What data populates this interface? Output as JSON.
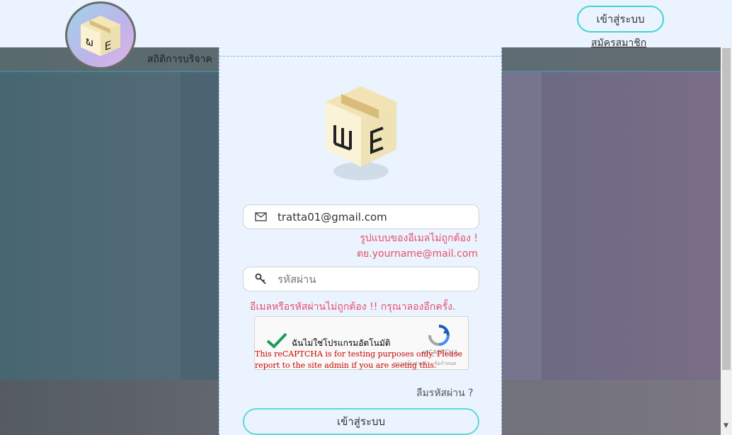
{
  "header": {
    "login_label": "เข้าสู่ระบบ",
    "signup_label": "สมัครสมาชิก",
    "logo_icon": "box-logo-icon"
  },
  "background": {
    "stat_label": "สถิติการบริจาค"
  },
  "modal": {
    "email": {
      "value": "tratta01@gmail.com",
      "icon": "envelope-icon",
      "error_line1": "รูปแบบของอีเมลไม่ถูกต้อง !",
      "error_line2": "ตย.yourname@mail.com"
    },
    "password": {
      "placeholder": "รหัสผ่าน",
      "icon": "key-icon"
    },
    "auth_error": "อีเมลหรือรหัสผ่านไม่ถูกต้อง !! กรุณาลองอีกครั้ง.",
    "captcha": {
      "label": "ฉันไม่ใช่โปรแกรมอัตโนมัติ",
      "brand": "reCAPTCHA",
      "links": "ความเป็นส่วนตัว - ข้อกำหนด",
      "warning": "This reCAPTCHA is for testing purposes only. Please report to the site admin if you are seeing this."
    },
    "forgot_label": "ลืมรหัสผ่าน ?",
    "submit_label": "เข้าสู่ระบบ"
  },
  "colors": {
    "accent": "#3fd6d2",
    "error": "#e8506a",
    "background": "#eaf3fe"
  }
}
